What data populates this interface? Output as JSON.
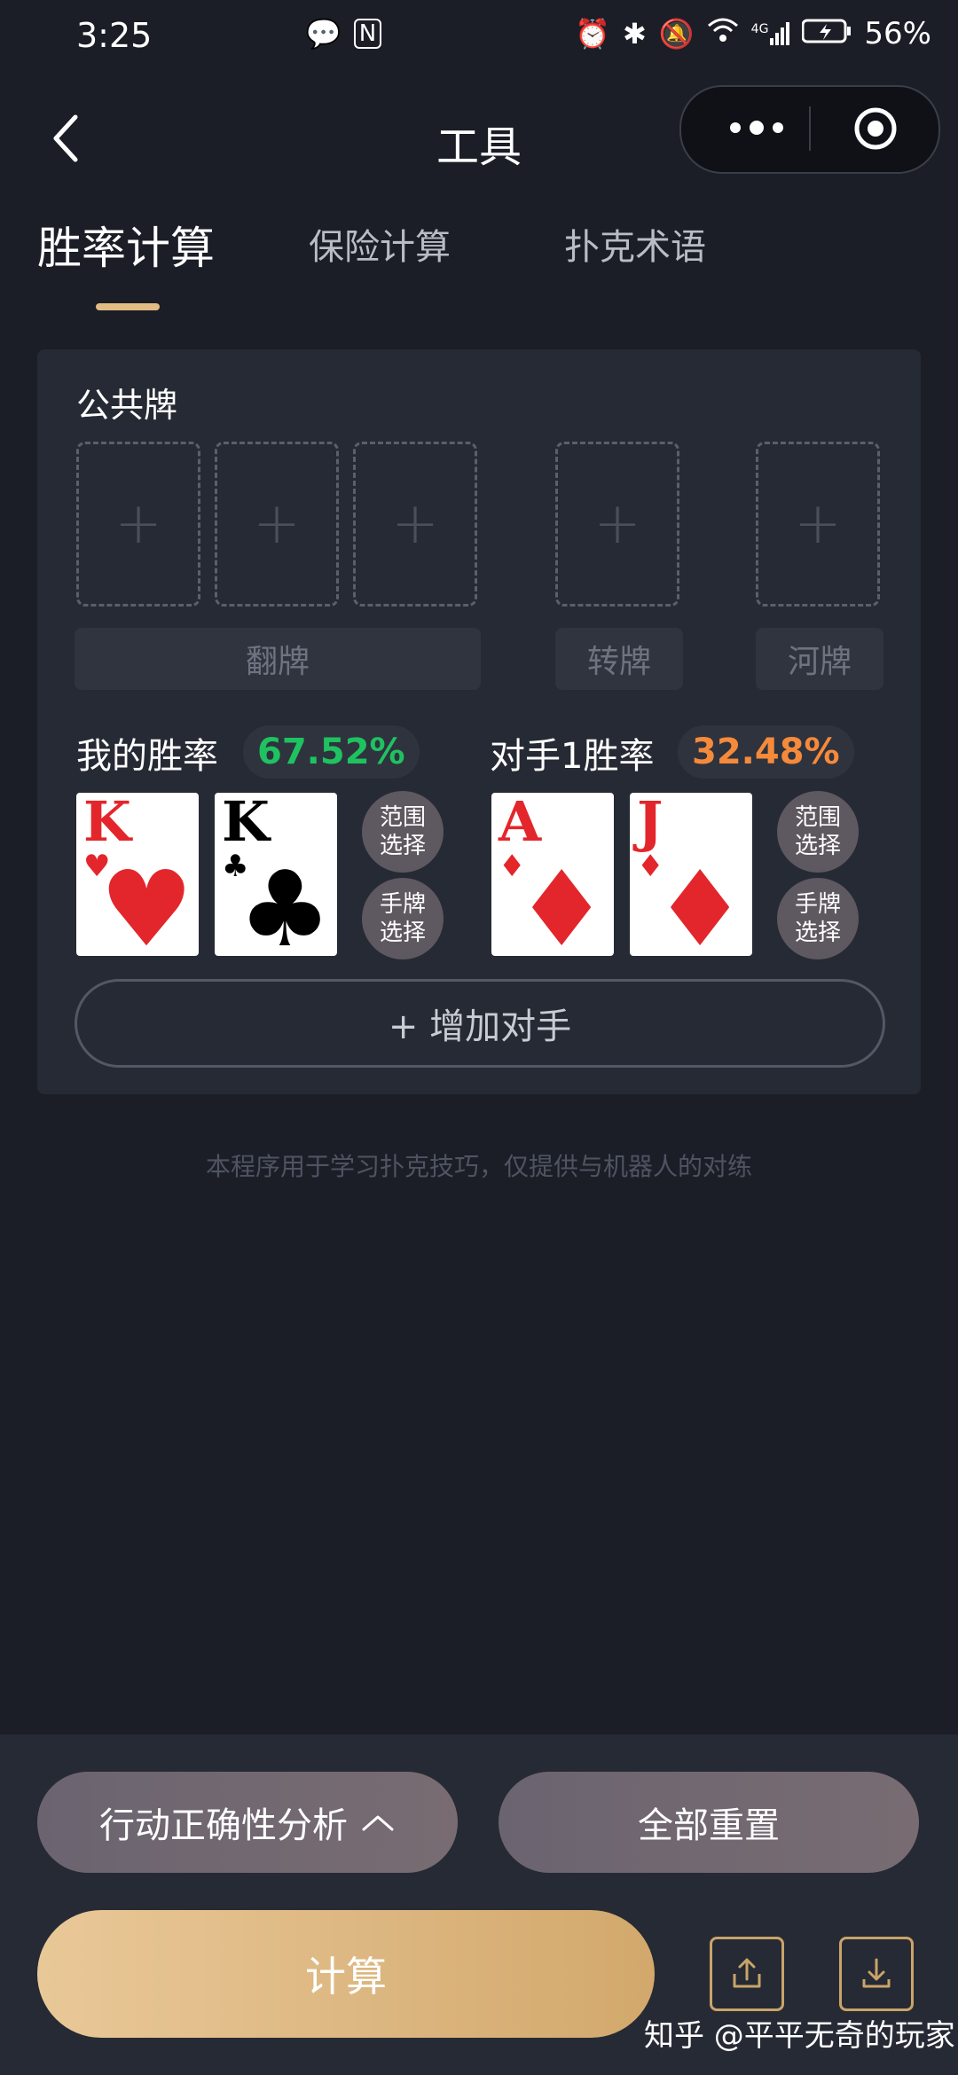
{
  "status_bar": {
    "time": "3:25",
    "icons": [
      "chat-bubble-icon",
      "nfc-icon",
      "alarm-icon",
      "bluetooth-icon",
      "mute-icon",
      "wifi-icon",
      "signal-4g-icon",
      "battery-icon"
    ],
    "network": "4G",
    "battery": "56%"
  },
  "header": {
    "title": "工具"
  },
  "tabs": [
    {
      "label": "胜率计算",
      "active": true
    },
    {
      "label": "保险计算",
      "active": false
    },
    {
      "label": "扑克术语",
      "active": false
    }
  ],
  "board": {
    "label": "公共牌",
    "slot_symbol": "+",
    "flop_label": "翻牌",
    "turn_label": "转牌",
    "river_label": "河牌"
  },
  "me": {
    "label": "我的胜率",
    "rate": "67.52%",
    "cards": [
      {
        "rank": "K",
        "suit": "♥",
        "color": "#e3262b"
      },
      {
        "rank": "K",
        "suit": "♣",
        "color": "#000000"
      }
    ]
  },
  "opponent": {
    "label": "对手1胜率",
    "rate": "32.48%",
    "cards": [
      {
        "rank": "A",
        "suit": "♦",
        "color": "#e3262b"
      },
      {
        "rank": "J",
        "suit": "♦",
        "color": "#e3262b"
      }
    ]
  },
  "buttons": {
    "range_line1": "范围",
    "range_line2": "选择",
    "hand_line1": "手牌",
    "hand_line2": "选择",
    "add_opponent": "+ 增加对手",
    "analysis": "行动正确性分析",
    "reset": "全部重置",
    "calculate": "计算"
  },
  "disclaimer": "本程序用于学习扑克技巧，仅提供与机器人的对练",
  "watermark": "知乎 @平平无奇的玩家",
  "colors": {
    "accent": "#e2bd83",
    "win_green": "#1fc260",
    "win_orange": "#f58a3b",
    "background": "#1b1e27",
    "panel": "#262a34"
  }
}
